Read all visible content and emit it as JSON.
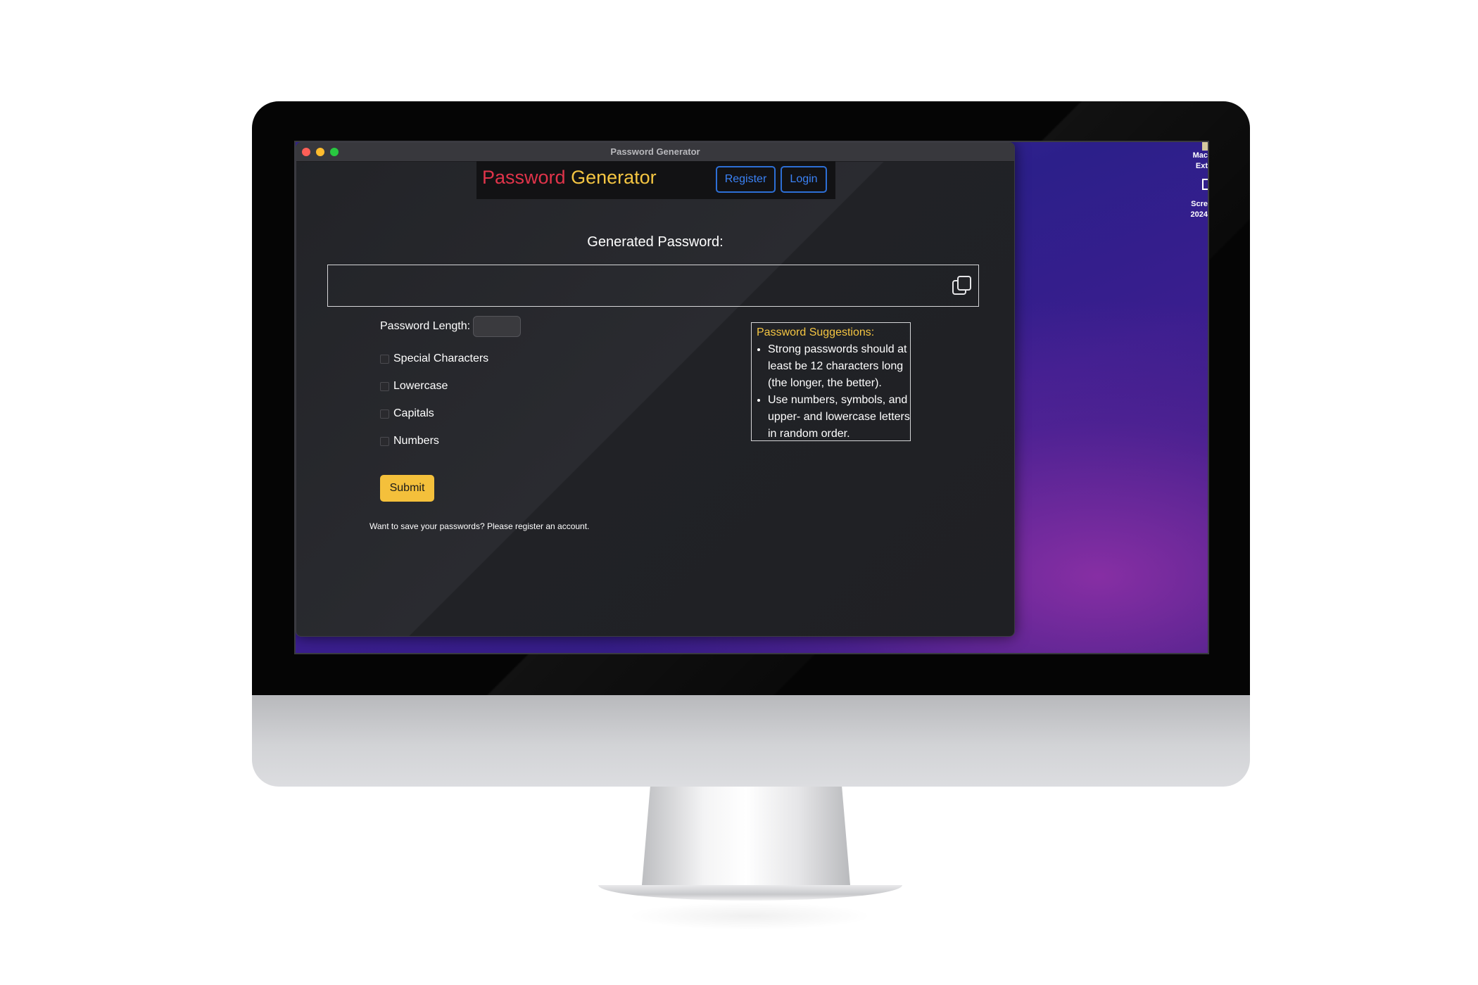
{
  "window": {
    "title": "Password Generator",
    "controls": [
      "close",
      "minimize",
      "maximize"
    ]
  },
  "navbar": {
    "brand_part1": "Password",
    "brand_part2": "Generator",
    "register_label": "Register",
    "login_label": "Login"
  },
  "generator": {
    "heading": "Generated Password:",
    "output_value": "",
    "copy_icon": "copy-icon"
  },
  "form": {
    "length_label": "Password Length:",
    "length_value": "",
    "options": [
      {
        "label": "Special Characters",
        "checked": false
      },
      {
        "label": "Lowercase",
        "checked": false
      },
      {
        "label": "Capitals",
        "checked": false
      },
      {
        "label": "Numbers",
        "checked": false
      }
    ],
    "submit_label": "Submit",
    "footer_note": "Want to save your passwords? Please register an account."
  },
  "suggestions": {
    "title": "Password Suggestions:",
    "items": [
      "Strong passwords should at least be 12 characters long (the longer, the better).",
      "Use numbers, symbols, and upper- and lowercase letters in random order."
    ]
  },
  "desktop": {
    "icon_labels": [
      "Mac",
      "Ext",
      "Scre",
      "2024"
    ]
  },
  "colors": {
    "brand_red": "#e0344a",
    "brand_yellow": "#f4c542",
    "link_blue": "#3b82f6",
    "submit_yellow": "#f4c03b"
  }
}
